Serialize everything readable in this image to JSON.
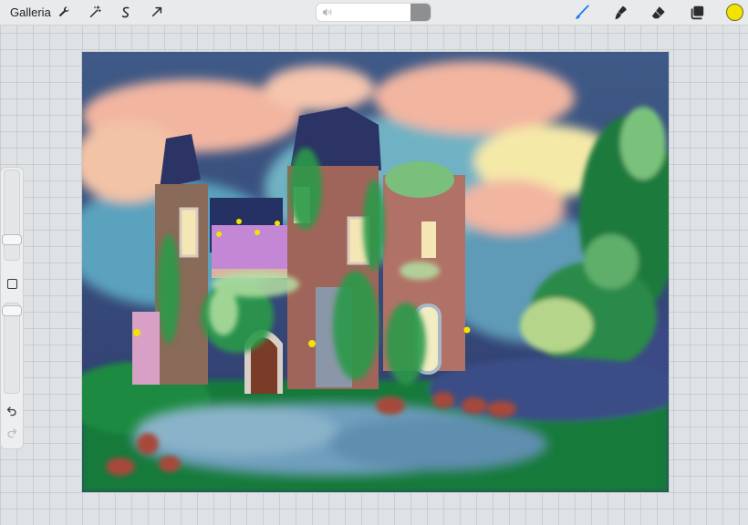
{
  "topbar": {
    "gallery_label": "Galleria",
    "tools_left": [
      "wrench-icon",
      "magic-wand-icon",
      "selection-icon",
      "transform-arrow-icon"
    ],
    "volume_icon": "speaker-icon",
    "tools_right": [
      "brush-icon",
      "smudge-icon",
      "eraser-icon",
      "layers-icon"
    ],
    "active_tool": "brush-icon",
    "active_color": "#f2e300",
    "accent_color": "#1a7cf0"
  },
  "sidebar": {
    "size_slider_icon": "size-slider",
    "opacity_slider_icon": "opacity-slider",
    "modify_icon": "square-modify-icon",
    "undo_icon": "undo-icon",
    "redo_icon": "redo-icon"
  },
  "artwork": {
    "subject": "painting-of-ivy-covered-castle-by-pond",
    "palette": [
      "#2d3a6b",
      "#f2b5a0",
      "#6fb2c3",
      "#2c8a47",
      "#a0655a",
      "#c487d6",
      "#f2e9a6"
    ]
  }
}
